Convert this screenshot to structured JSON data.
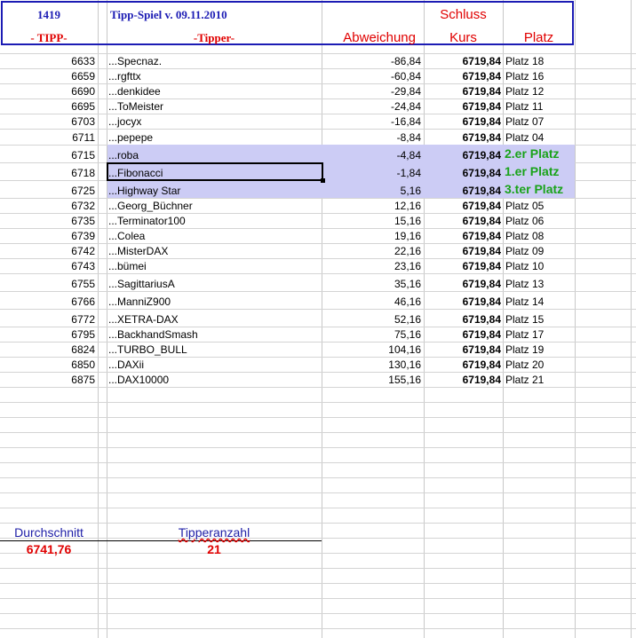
{
  "header": {
    "col_a_top": "1419",
    "title": "Tipp-Spiel v. 09.11.2010",
    "schluss": "Schluss",
    "col_a_label": "- TIPP-",
    "tipper_label": "-Tipper-",
    "abweichung_label": "Abweichung",
    "kurs_label": "Kurs",
    "platz_label": "Platz"
  },
  "rows": [
    {
      "tipp": "6633",
      "name": "...Specnaz.",
      "abw": "-86,84",
      "kurs": "6719,84",
      "platz": "Platz 18"
    },
    {
      "tipp": "6659",
      "name": "...rgfttx",
      "abw": "-60,84",
      "kurs": "6719,84",
      "platz": "Platz 16"
    },
    {
      "tipp": "6690",
      "name": "...denkidee",
      "abw": "-29,84",
      "kurs": "6719,84",
      "platz": "Platz 12"
    },
    {
      "tipp": "6695",
      "name": "...ToMeister",
      "abw": "-24,84",
      "kurs": "6719,84",
      "platz": "Platz 11"
    },
    {
      "tipp": "6703",
      "name": "...jocyx",
      "abw": "-16,84",
      "kurs": "6719,84",
      "platz": "Platz 07"
    },
    {
      "tipp": "6711",
      "name": "...pepepe",
      "abw": "-8,84",
      "kurs": "6719,84",
      "platz": "Platz 04"
    },
    {
      "tipp": "6715",
      "name": "...roba",
      "abw": "-4,84",
      "kurs": "6719,84",
      "platz": "2.er Platz"
    },
    {
      "tipp": "6718",
      "name": "...Fibonacci",
      "abw": "-1,84",
      "kurs": "6719,84",
      "platz": "1.er Platz"
    },
    {
      "tipp": "6725",
      "name": "...Highway Star",
      "abw": "5,16",
      "kurs": "6719,84",
      "platz": "3.ter Platz"
    },
    {
      "tipp": "6732",
      "name": "...Georg_Büchner",
      "abw": "12,16",
      "kurs": "6719,84",
      "platz": "Platz 05"
    },
    {
      "tipp": "6735",
      "name": "...Terminator100",
      "abw": "15,16",
      "kurs": "6719,84",
      "platz": "Platz 06"
    },
    {
      "tipp": "6739",
      "name": "...Colea",
      "abw": "19,16",
      "kurs": "6719,84",
      "platz": "Platz 08"
    },
    {
      "tipp": "6742",
      "name": "...MisterDAX",
      "abw": "22,16",
      "kurs": "6719,84",
      "platz": "Platz 09"
    },
    {
      "tipp": "6743",
      "name": "...bümei",
      "abw": "23,16",
      "kurs": "6719,84",
      "platz": "Platz 10"
    },
    {
      "tipp": "6755",
      "name": "...SagittariusA",
      "abw": "35,16",
      "kurs": "6719,84",
      "platz": "Platz 13"
    },
    {
      "tipp": "6766",
      "name": "...ManniZ900",
      "abw": "46,16",
      "kurs": "6719,84",
      "platz": "Platz 14"
    },
    {
      "tipp": "6772",
      "name": "...XETRA-DAX",
      "abw": "52,16",
      "kurs": "6719,84",
      "platz": "Platz 15"
    },
    {
      "tipp": "6795",
      "name": "...BackhandSmash",
      "abw": "75,16",
      "kurs": "6719,84",
      "platz": "Platz 17"
    },
    {
      "tipp": "6824",
      "name": "...TURBO_BULL",
      "abw": "104,16",
      "kurs": "6719,84",
      "platz": "Platz 19"
    },
    {
      "tipp": "6850",
      "name": "...DAXii",
      "abw": "130,16",
      "kurs": "6719,84",
      "platz": "Platz 20"
    },
    {
      "tipp": "6875",
      "name": "...DAX10000",
      "abw": "155,16",
      "kurs": "6719,84",
      "platz": "Platz 21"
    }
  ],
  "summary": {
    "durchschnitt_label": "Durchschnitt",
    "durchschnitt_value": "6741,76",
    "tipperanzahl_label": "Tipperanzahl",
    "tipperanzahl_value": "21"
  },
  "colors": {
    "header_border": "#1c1cb4",
    "header_red": "#e00000",
    "highlight_row": "#ccccf5",
    "podium_green": "#1aa31a"
  }
}
